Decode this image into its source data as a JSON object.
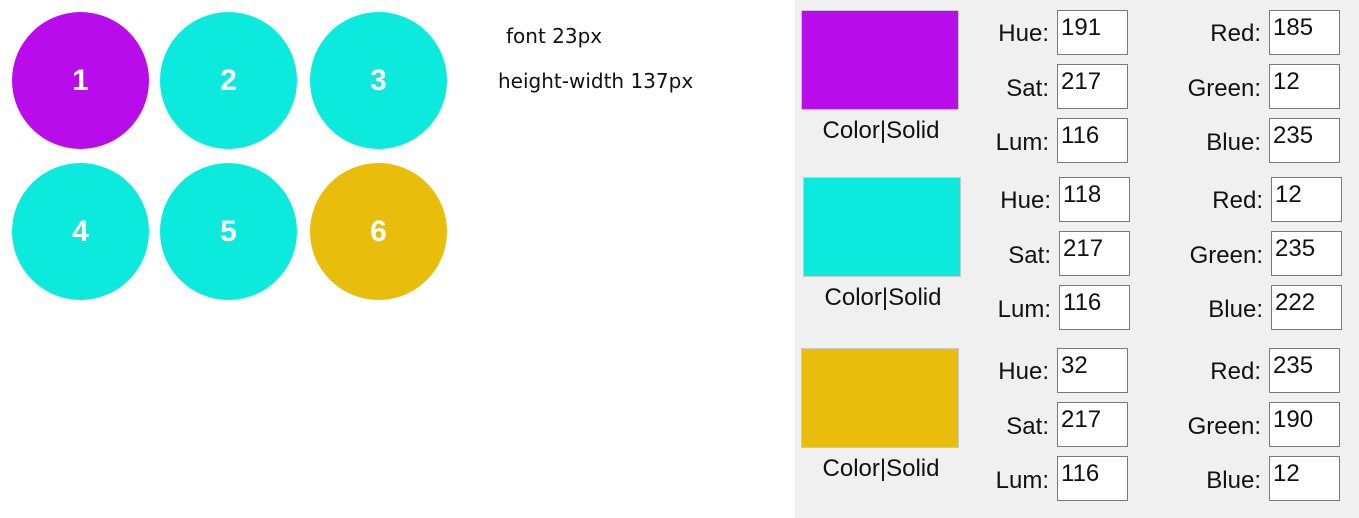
{
  "circles": [
    {
      "label": "1",
      "color": "#b90ceb"
    },
    {
      "label": "2",
      "color": "#0ceade"
    },
    {
      "label": "3",
      "color": "#0ceade"
    },
    {
      "label": "4",
      "color": "#0ceade"
    },
    {
      "label": "5",
      "color": "#0ceade"
    },
    {
      "label": "6",
      "color": "#e8bd0c"
    }
  ],
  "notes": {
    "font": "font 23px",
    "size": "height-width 137px"
  },
  "labels": {
    "hue": "Hue:",
    "sat": "Sat:",
    "lum": "Lum:",
    "red": "Red:",
    "green": "Green:",
    "blue": "Blue:"
  },
  "colors": [
    {
      "swatch_label": "Color|Solid",
      "swatch_color": "#b90ceb",
      "hue": "191",
      "sat": "217",
      "lum": "116",
      "red": "185",
      "green": "12",
      "blue": "235"
    },
    {
      "swatch_label": "Color|Solid",
      "swatch_color": "#0ceade",
      "hue": "118",
      "sat": "217",
      "lum": "116",
      "red": "12",
      "green": "235",
      "blue": "222"
    },
    {
      "swatch_label": "Color|Solid",
      "swatch_color": "#e8bd0c",
      "hue": "32",
      "sat": "217",
      "lum": "116",
      "red": "235",
      "green": "190",
      "blue": "12"
    }
  ]
}
